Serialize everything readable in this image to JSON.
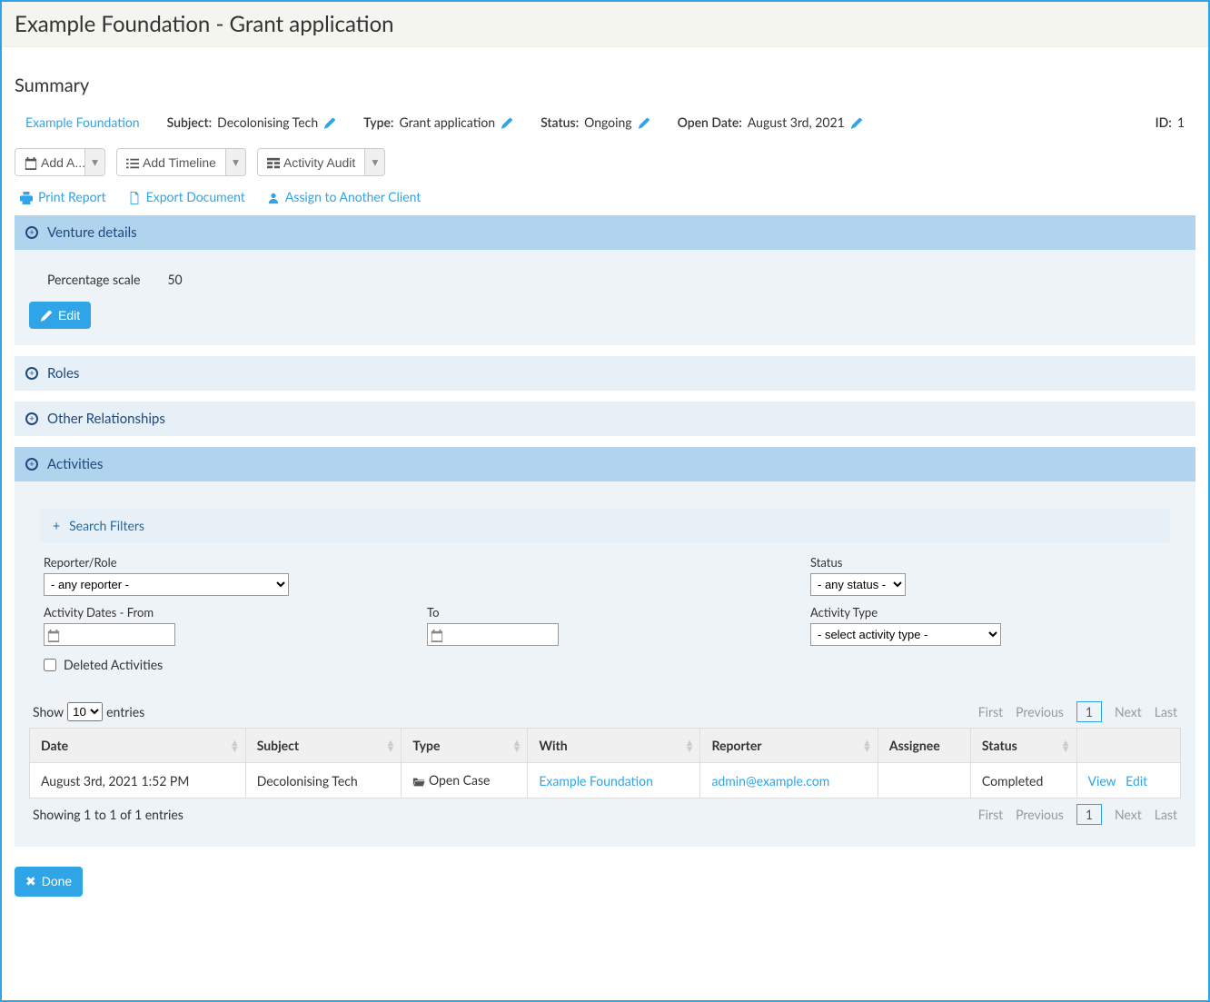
{
  "header": {
    "title": "Example Foundation - Grant application"
  },
  "summary": {
    "heading": "Summary",
    "client_link": "Example Foundation",
    "subject_label": "Subject:",
    "subject_value": "Decolonising Tech",
    "type_label": "Type:",
    "type_value": "Grant application",
    "status_label": "Status:",
    "status_value": "Ongoing",
    "open_date_label": "Open Date:",
    "open_date_value": "August 3rd, 2021",
    "id_label": "ID:",
    "id_value": "1"
  },
  "buttons": {
    "add_activity": "Add A...",
    "add_timeline": "Add Timeline",
    "activity_audit": "Activity Audit"
  },
  "links": {
    "print": "Print Report",
    "export": "Export Document",
    "assign": "Assign to Another Client"
  },
  "venture": {
    "title": "Venture details",
    "scale_label": "Percentage scale",
    "scale_value": "50",
    "edit": "Edit"
  },
  "roles": {
    "title": "Roles"
  },
  "other": {
    "title": "Other Relationships"
  },
  "activities": {
    "title": "Activities",
    "filters": {
      "title": "Search Filters",
      "reporter_label": "Reporter/Role",
      "reporter_value": "- any reporter -",
      "status_label": "Status",
      "status_value": "- any status -",
      "date_from_label": "Activity Dates - From",
      "date_to_label": "To",
      "type_label": "Activity Type",
      "type_value": "- select activity type -",
      "deleted_label": "Deleted Activities"
    },
    "table": {
      "show_prefix": "Show",
      "show_value": "10",
      "show_suffix": "entries",
      "columns": [
        "Date",
        "Subject",
        "Type",
        "With",
        "Reporter",
        "Assignee",
        "Status",
        ""
      ],
      "rows": [
        {
          "date": "August 3rd, 2021 1:52 PM",
          "subject": "Decolonising Tech",
          "type": "Open Case",
          "with": "Example Foundation",
          "reporter": "admin@example.com",
          "assignee": "",
          "status": "Completed",
          "view": "View",
          "edit": "Edit"
        }
      ],
      "info": "Showing 1 to 1 of 1 entries",
      "pager": {
        "first": "First",
        "prev": "Previous",
        "page": "1",
        "next": "Next",
        "last": "Last"
      }
    }
  },
  "done": {
    "label": "Done"
  }
}
